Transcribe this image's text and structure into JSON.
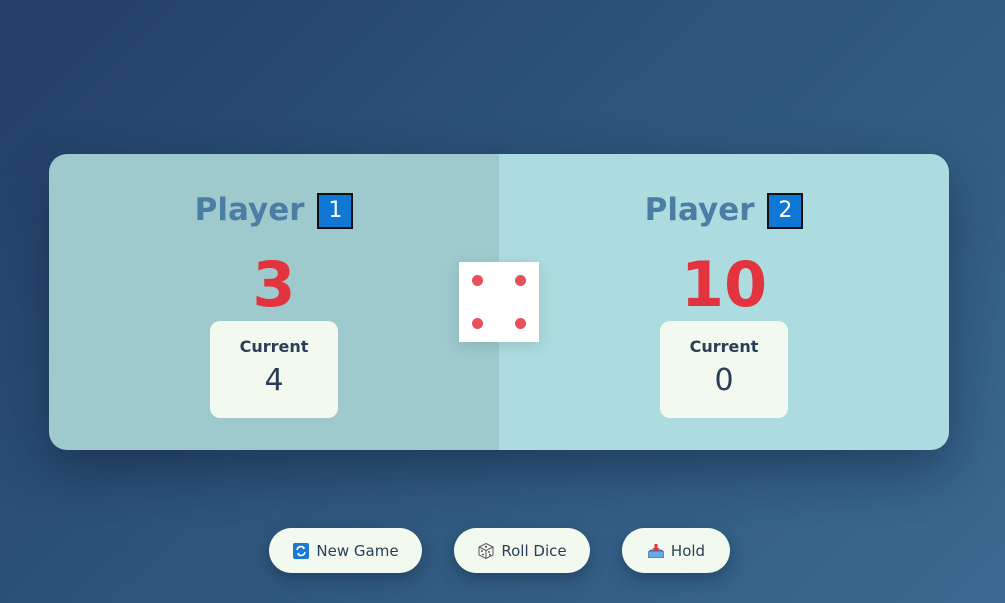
{
  "players": [
    {
      "label": "Player",
      "number": "1",
      "score": "3",
      "current_label": "Current",
      "current_score": "4"
    },
    {
      "label": "Player",
      "number": "2",
      "score": "10",
      "current_label": "Current",
      "current_score": "0"
    }
  ],
  "dice": {
    "value": 4,
    "pip_color": "#e8505b"
  },
  "buttons": {
    "new_game": {
      "label": "New Game",
      "icon": "refresh-icon"
    },
    "roll_dice": {
      "label": "Roll Dice",
      "icon": "dice-icon"
    },
    "hold": {
      "label": "Hold",
      "icon": "inbox-tray-icon"
    }
  },
  "colors": {
    "score": "#e2333f",
    "player_name": "#4a7ea4",
    "badge": "#0f77d4",
    "panel_left": "#9ecacd",
    "panel_right": "#acdcdf"
  }
}
